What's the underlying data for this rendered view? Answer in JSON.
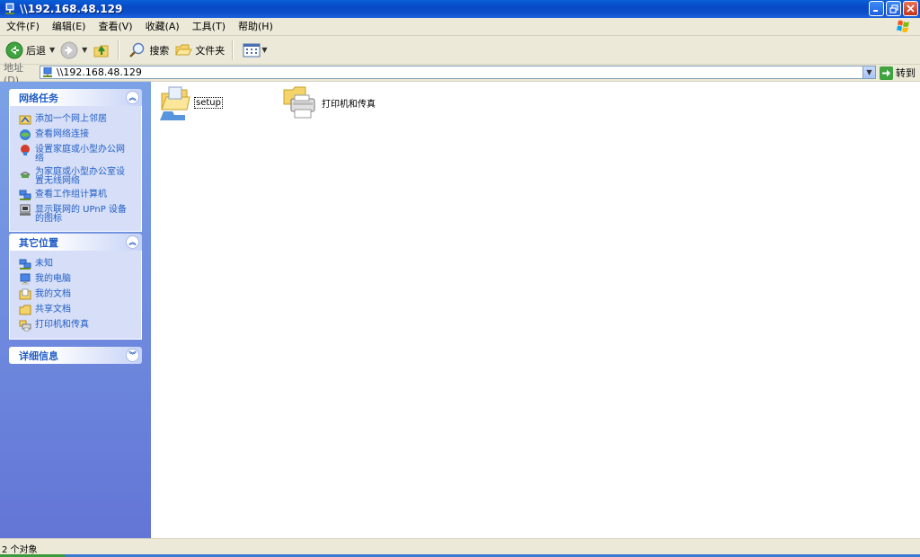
{
  "window": {
    "title": "\\\\192.168.48.129"
  },
  "menu": [
    "文件(F)",
    "编辑(E)",
    "查看(V)",
    "收藏(A)",
    "工具(T)",
    "帮助(H)"
  ],
  "toolbar": {
    "back": "后退",
    "search": "搜索",
    "folders": "文件夹"
  },
  "address": {
    "label": "地址(D)",
    "value": "\\\\192.168.48.129",
    "go": "转到"
  },
  "panels": {
    "network_tasks": {
      "title": "网络任务",
      "items": [
        "添加一个网上邻居",
        "查看网络连接",
        "设置家庭或小型办公网络",
        "为家庭或小型办公室设置无线网络",
        "查看工作组计算机",
        "显示联网的 UPnP 设备的图标"
      ]
    },
    "other_places": {
      "title": "其它位置",
      "items": [
        "未知",
        "我的电脑",
        "我的文档",
        "共享文档",
        "打印机和传真"
      ]
    },
    "details": {
      "title": "详细信息"
    }
  },
  "files": [
    "setup",
    "打印机和传真"
  ],
  "status": {
    "text": "2 个对象"
  }
}
